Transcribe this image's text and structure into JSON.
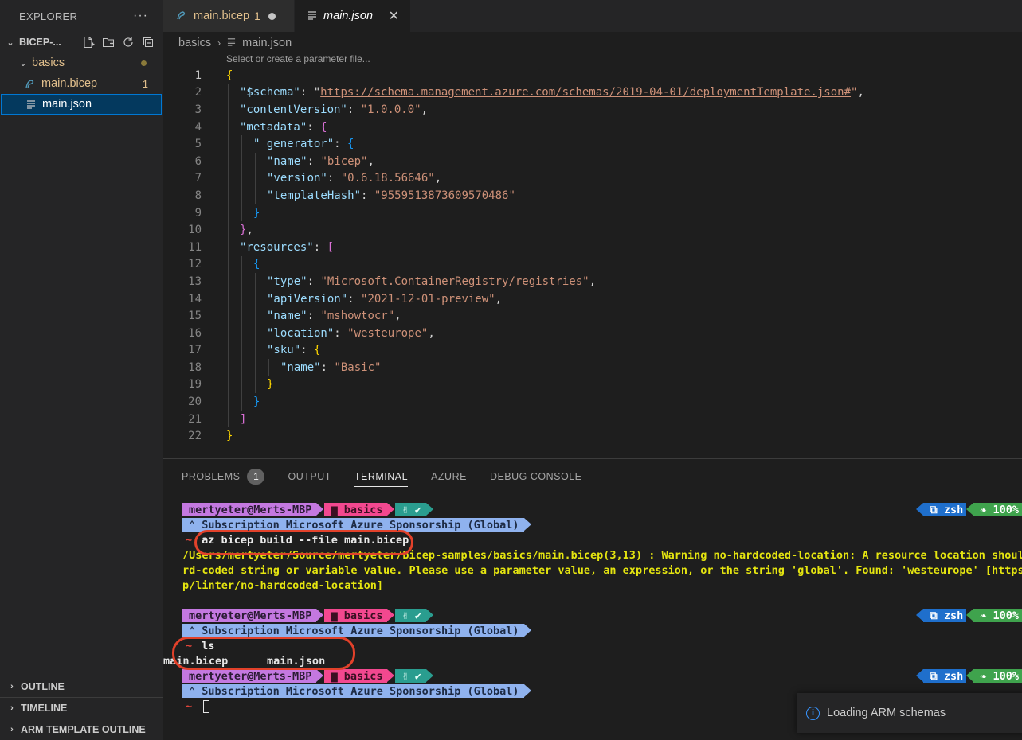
{
  "sidebar": {
    "header": "EXPLORER",
    "more": "···",
    "folder": "BICEP-...",
    "tree": {
      "basics": "basics",
      "bicep_file": "main.bicep",
      "bicep_badge": "1",
      "json_file": "main.json"
    },
    "bottom_sections": [
      "OUTLINE",
      "TIMELINE",
      "ARM TEMPLATE OUTLINE"
    ]
  },
  "tabs": [
    {
      "label": "main.bicep",
      "badge": "1",
      "icon": "bicep-file-icon"
    },
    {
      "label": "main.json",
      "icon": "json-file-icon"
    }
  ],
  "breadcrumb": {
    "folder": "basics",
    "file": "main.json"
  },
  "editor_hint": "Select or create a parameter file...",
  "editor": {
    "line_numbers": [
      "1",
      "2",
      "3",
      "4",
      "5",
      "6",
      "7",
      "8",
      "9",
      "10",
      "11",
      "12",
      "13",
      "14",
      "15",
      "16",
      "17",
      "18",
      "19",
      "20",
      "21",
      "22"
    ],
    "schema_key": "\"$schema\"",
    "schema_url": "https://schema.management.azure.com/schemas/2019-04-01/deploymentTemplate.json#",
    "content_version_key": "\"contentVersion\"",
    "content_version": "\"1.0.0.0\"",
    "metadata_key": "\"metadata\"",
    "generator_key": "\"_generator\"",
    "name_key": "\"name\"",
    "gen_name": "\"bicep\"",
    "version_key": "\"version\"",
    "gen_version": "\"0.6.18.56646\"",
    "hash_key": "\"templateHash\"",
    "gen_hash": "\"9559513873609570486\"",
    "resources_key": "\"resources\"",
    "type_key": "\"type\"",
    "res_type": "\"Microsoft.ContainerRegistry/registries\"",
    "api_key": "\"apiVersion\"",
    "res_api": "\"2021-12-01-preview\"",
    "res_name": "\"mshowtocr\"",
    "location_key": "\"location\"",
    "res_location": "\"westeurope\"",
    "sku_key": "\"sku\"",
    "sku_name": "\"Basic\""
  },
  "panel": {
    "tabs": {
      "problems": "PROBLEMS",
      "problems_count": "1",
      "output": "OUTPUT",
      "terminal": "TERMINAL",
      "azure": "AZURE",
      "debug": "DEBUG CONSOLE"
    }
  },
  "terminal": {
    "user": "mertyeter@Merts-MBP",
    "dir": "basics",
    "git": "✌ ✔",
    "subscription": "⌃ Subscription Microsoft Azure Sponsorship (Global)",
    "shell": "⧉ zsh",
    "battery": "❧ 100%",
    "prompt": "~",
    "cmd1": "az bicep build --file main.bicep",
    "warn1": "/Users/mertyeter/Source/mertyeter/bicep-samples/basics/main.bicep(3,13) : Warning no-hardcoded-location: A resource location should",
    "warn2": "rd-coded string or variable value. Please use a parameter value, an expression, or the string 'global'. Found: 'westeurope' [https:/",
    "warn3": "p/linter/no-hardcoded-location]",
    "cmd2": "ls",
    "ls_out": "main.bicep      main.json"
  },
  "notification": {
    "text": "Loading ARM schemas",
    "icon": "info-icon"
  }
}
